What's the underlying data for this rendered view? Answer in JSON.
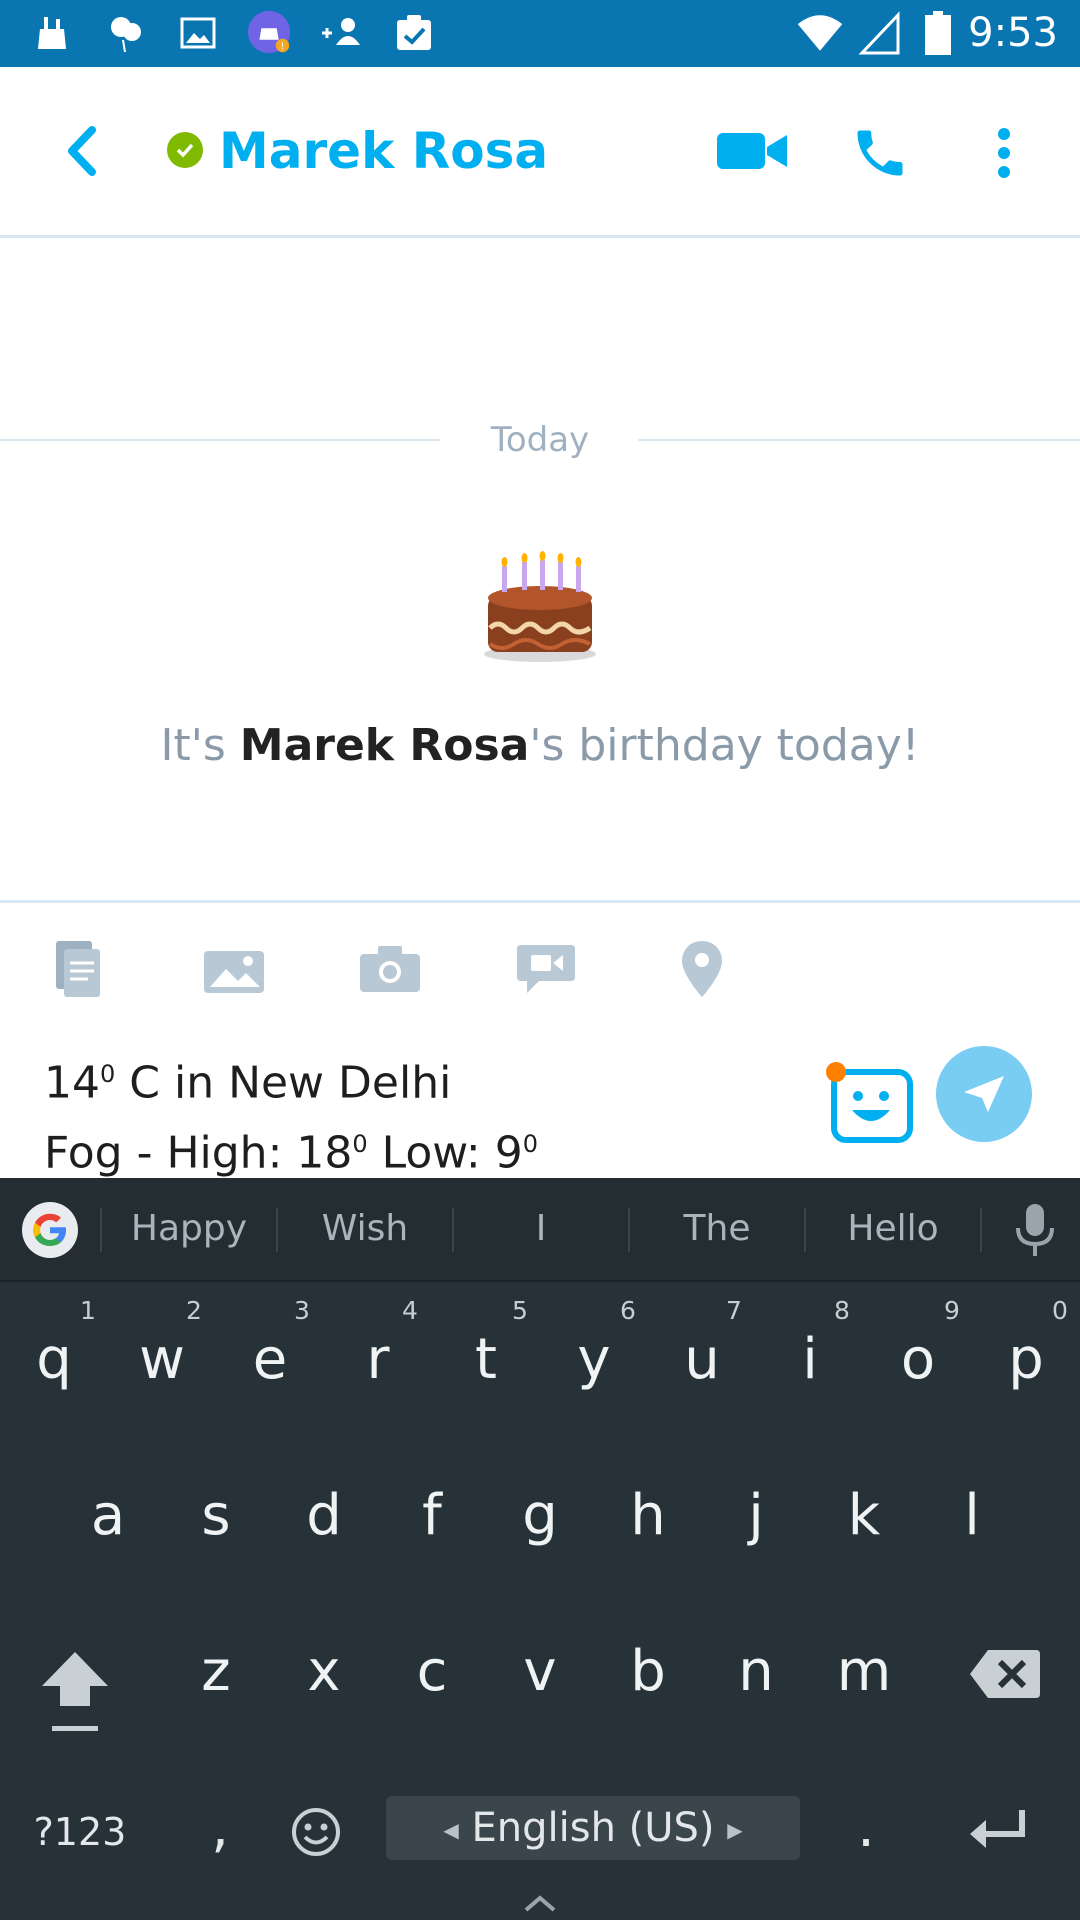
{
  "status_bar": {
    "time": "9:53",
    "icons": [
      "clean-icon",
      "balloons-icon",
      "gallery-icon",
      "app-alert-icon",
      "add-contact-icon",
      "task-check-icon",
      "wifi-icon",
      "signal-icon",
      "battery-icon"
    ]
  },
  "header": {
    "contact_name": "Marek Rosa",
    "presence": "online",
    "icons": [
      "back-arrow-icon",
      "video-call-icon",
      "phone-icon",
      "more-vertical-icon"
    ],
    "accent_color": "#00aff0"
  },
  "chat": {
    "date_divider": "Today",
    "birthday": {
      "prefix": "It's ",
      "name": "Marek Rosa",
      "suffix": "'s birthday today!"
    }
  },
  "toolbar": {
    "icons": [
      "file-icon",
      "photo-icon",
      "camera-icon",
      "video-message-icon",
      "location-pin-icon"
    ]
  },
  "compose": {
    "line1_pre": "14",
    "line1_sup": "0",
    "line1_post": " C in New Delhi",
    "line2_pre": "Fog - High: 18",
    "line2_sup1": "0",
    "line2_mid": " Low: 9",
    "line2_sup2": "0",
    "icons": [
      "emoticon-icon",
      "send-icon"
    ]
  },
  "keyboard": {
    "suggestions": [
      "Happy",
      "Wish",
      "I",
      "The",
      "Hello"
    ],
    "row1": [
      "q",
      "w",
      "e",
      "r",
      "t",
      "y",
      "u",
      "i",
      "o",
      "p"
    ],
    "row1_hints": [
      "1",
      "2",
      "3",
      "4",
      "5",
      "6",
      "7",
      "8",
      "9",
      "0"
    ],
    "row2": [
      "a",
      "s",
      "d",
      "f",
      "g",
      "h",
      "j",
      "k",
      "l"
    ],
    "row3": [
      "z",
      "x",
      "c",
      "v",
      "b",
      "n",
      "m"
    ],
    "symbols_label": "?123",
    "comma": ",",
    "period": ".",
    "space_label": "English (US)",
    "icons": [
      "google-icon",
      "mic-icon",
      "shift-icon",
      "backspace-icon",
      "emoji-icon",
      "enter-icon",
      "chevron-up-icon"
    ]
  }
}
